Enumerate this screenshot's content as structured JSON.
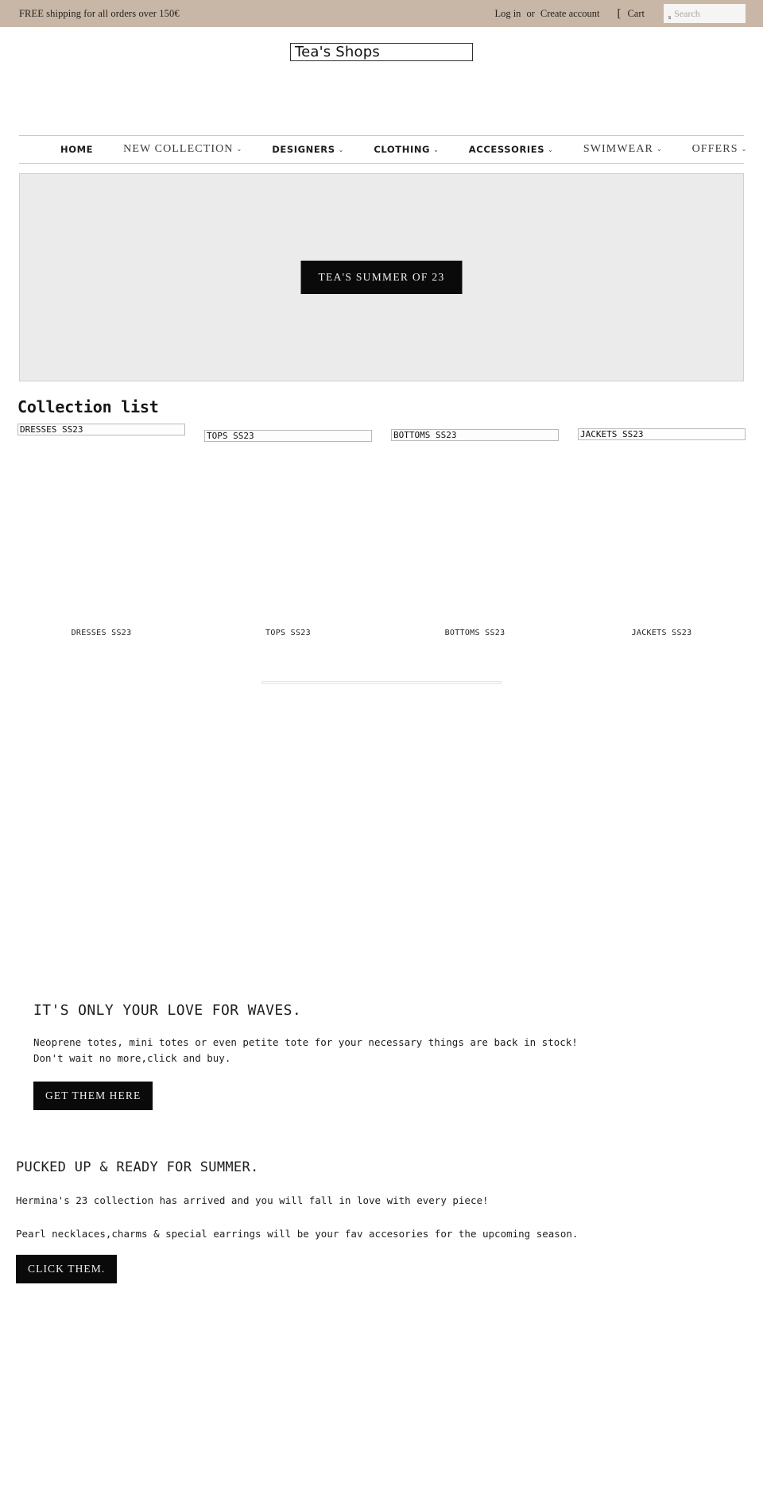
{
  "topbar": {
    "message": "FREE shipping for all orders over 150€",
    "login_label": "Log in",
    "or_label": "or",
    "create_account_label": "Create account",
    "cart_icon": "cart-icon",
    "cart_label": "Cart",
    "search_icon": "search-icon",
    "search_placeholder": "Search",
    "search_value": "",
    "bar_color": "#c8b7a6"
  },
  "header": {
    "logo_text": "Tea's Shops"
  },
  "nav": {
    "items": [
      {
        "label": "HOME",
        "caret": "",
        "style": "bold"
      },
      {
        "label": "NEW COLLECTION",
        "caret": "⌄",
        "style": "light"
      },
      {
        "label": "DESIGNERS",
        "caret": "⌄",
        "style": "bold"
      },
      {
        "label": "CLOTHING",
        "caret": "⌄",
        "style": "bold"
      },
      {
        "label": "ACCESSORIES",
        "caret": "⌄",
        "style": "bold"
      },
      {
        "label": "SWIMWEAR",
        "caret": "⌄",
        "style": "light"
      },
      {
        "label": "OFFERS",
        "caret": "⌄",
        "style": "light"
      }
    ]
  },
  "hero": {
    "cta_label": "TEA'S SUMMER OF 23",
    "background_color": "#ebebeb",
    "cta_color": "#0a0a0a"
  },
  "collection_list": {
    "title": "Collection list",
    "items": [
      {
        "alt_text": "DRESSES SS23",
        "caption": "DRESSES SS23"
      },
      {
        "alt_text": "TOPS SS23",
        "caption": "TOPS SS23"
      },
      {
        "alt_text": "BOTTOMS SS23",
        "caption": "BOTTOMS SS23"
      },
      {
        "alt_text": "JACKETS SS23",
        "caption": "JACKETS SS23"
      }
    ]
  },
  "feature": {
    "title": "IT'S ONLY YOUR LOVE FOR WAVES.",
    "line1": "Neoprene totes, mini totes or even petite tote for your necessary things are back in stock!",
    "line2": "Don't wait no more,click and buy.",
    "button_label": "GET THEM HERE"
  },
  "promo": {
    "title": "PUCKED UP & READY FOR SUMMER.",
    "line1": "Hermina's 23 collection has arrived and you will fall in love with every piece!",
    "line2": "Pearl necklaces,charms & special earrings will be your fav accesories for the upcoming season.",
    "button_label": "CLICK THEM."
  }
}
